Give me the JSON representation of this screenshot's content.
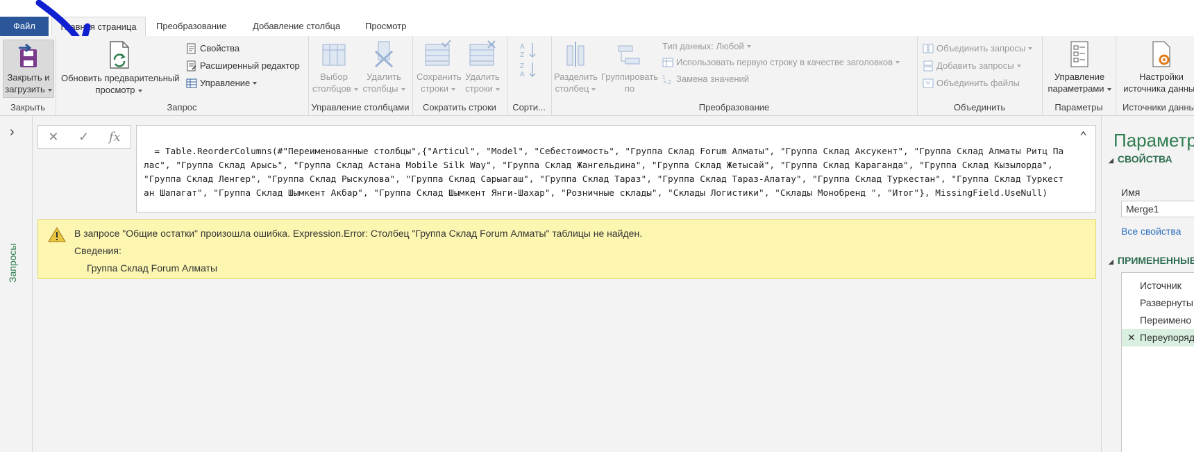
{
  "tabs": {
    "file": "Файл",
    "home": "Главная страница",
    "transform": "Преобразование",
    "add_column": "Добавление столбца",
    "view": "Просмотр"
  },
  "ribbon": {
    "close": {
      "close_load_line1": "Закрыть и",
      "close_load_line2": "загрузить",
      "label": "Закрыть"
    },
    "query": {
      "refresh_line1": "Обновить предварительный",
      "refresh_line2": "просмотр",
      "properties": "Свойства",
      "advanced_editor": "Расширенный редактор",
      "manage": "Управление",
      "label": "Запрос"
    },
    "manage_columns": {
      "choose_line1": "Выбор",
      "choose_line2": "столбцов",
      "remove_line1": "Удалить",
      "remove_line2": "столбцы",
      "label": "Управление столбцами"
    },
    "reduce_rows": {
      "keep_line1": "Сохранить",
      "keep_line2": "строки",
      "remove_line1": "Удалить",
      "remove_line2": "строки",
      "label": "Сократить строки"
    },
    "sort": {
      "label": "Сорти..."
    },
    "transform": {
      "split_line1": "Разделить",
      "split_line2": "столбец",
      "group_line1": "Группировать",
      "group_line2": "по",
      "data_type": "Тип данных: Любой",
      "first_row_headers": "Использовать первую строку в качестве заголовков",
      "replace_values": "Замена значений",
      "label": "Преобразование"
    },
    "combine": {
      "merge_queries": "Объединить запросы",
      "append_queries": "Добавить запросы",
      "combine_files": "Объединить файлы",
      "label": "Объединить"
    },
    "parameters": {
      "manage_line1": "Управление",
      "manage_line2": "параметрами",
      "label": "Параметры"
    },
    "data_sources": {
      "settings_line1": "Настройки",
      "settings_line2": "источника данных",
      "label": "Источники данных"
    }
  },
  "left_pane": {
    "queries_label": "Запросы"
  },
  "formula": {
    "fx_label": "fx",
    "text": "= Table.ReorderColumns(#\"Переименованные столбцы\",{\"Articul\", \"Model\", \"Себестоимость\", \"Группа Склад Forum Алматы\", \"Группа Склад Аксукент\", \"Группа Склад Алматы Ритц Палас\", \"Группа Склад Арысь\", \"Группа Склад Астана Mobile Silk Way\", \"Группа Склад Жангельдина\", \"Группа Склад Жетысай\", \"Группа Склад Караганда\", \"Группа Склад Кызылорда\", \"Группа Склад Ленгер\", \"Группа Склад Рыскулова\", \"Группа Склад Сарыагаш\", \"Группа Склад Тараз\", \"Группа Склад Тараз-Алатау\", \"Группа Склад Туркестан\", \"Группа Склад Туркестан Шапагат\", \"Группа Склад Шымкент Акбар\", \"Группа Склад Шымкент Янги-Шахар\", \"Розничные склады\", \"Склады Логистики\", \"Склады Монобренд \", \"Итог\"}, MissingField.UseNull)"
  },
  "error": {
    "message": "В запросе \"Общие остатки\" произошла ошибка. Expression.Error: Столбец \"Группа Склад Forum Алматы\" таблицы не найден.",
    "details_label": "Сведения:",
    "details_value": "Группа Склад Forum Алматы"
  },
  "right_pane": {
    "title": "Параметры",
    "properties_header": "СВОЙСТВА",
    "name_label": "Имя",
    "name_value": "Merge1",
    "all_properties_link": "Все свойства",
    "applied_steps_header": "ПРИМЕНЕННЫЕ",
    "steps": [
      "Источник",
      "Развернуты",
      "Переимено",
      "Переупоряд"
    ]
  },
  "colors": {
    "accent_green": "#2e7d4f",
    "file_tab_blue": "#2b579a",
    "error_yellow": "#fdf6b0",
    "annotation_blue": "#1020d0"
  }
}
